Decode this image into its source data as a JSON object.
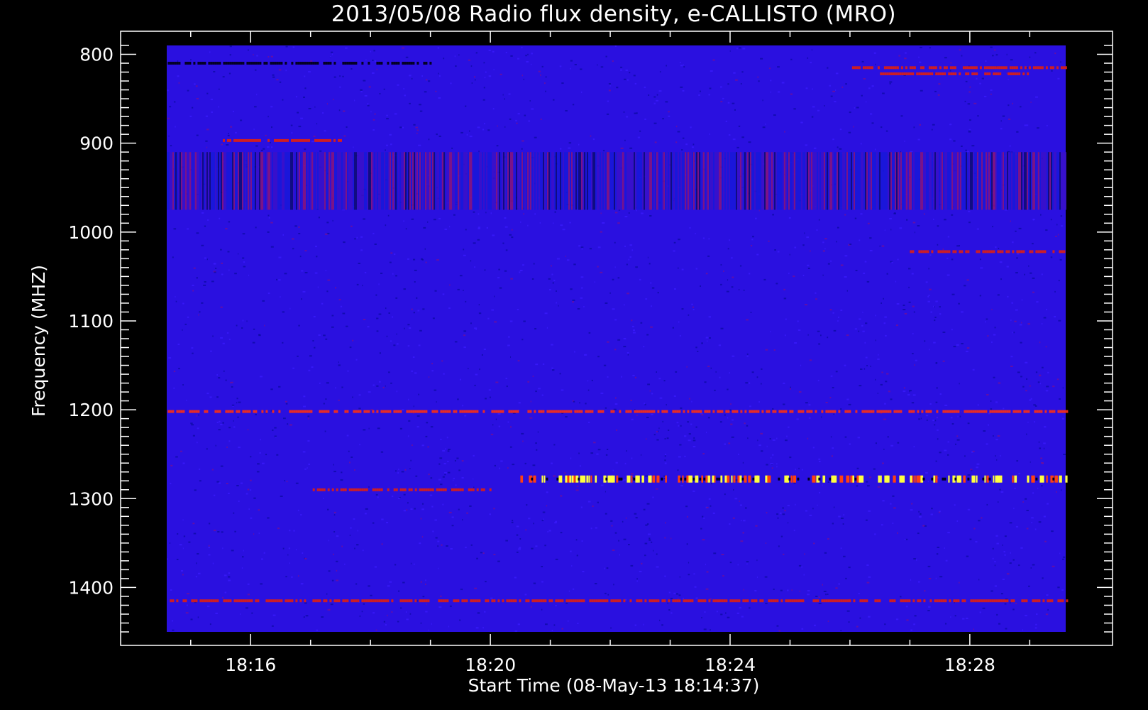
{
  "chart_data": {
    "type": "heatmap",
    "title": "2013/05/08  Radio flux density, e-CALLISTO (MRO)",
    "xlabel": "Start Time (08-May-13 18:14:37)",
    "ylabel": "Frequency (MHZ)",
    "x_start": "18:14:37",
    "x_end": "18:29:37",
    "xlim_minutes_after_18_00": [
      14.6,
      29.6
    ],
    "ylim": [
      1450,
      790
    ],
    "y_axis_inverted": true,
    "x_ticks": [
      "18:16",
      "18:20",
      "18:24",
      "18:28"
    ],
    "y_ticks": [
      800,
      900,
      1000,
      1100,
      1200,
      1300,
      1400
    ],
    "colormap": [
      "#000000",
      "#0000ff",
      "#ff0000",
      "#ffff00"
    ],
    "background_color": "#2a10e0",
    "features": [
      {
        "type": "band",
        "freq": 810,
        "level": "low",
        "t_start": "18:14:37",
        "t_end": "18:19:00"
      },
      {
        "type": "band",
        "freq": 815,
        "level": "high",
        "t_start": "18:26:00",
        "t_end": "18:29:37"
      },
      {
        "type": "band",
        "freq": 822,
        "level": "high",
        "t_start": "18:26:30",
        "t_end": "18:29:00"
      },
      {
        "type": "band",
        "freq": 897,
        "level": "high",
        "t_start": "18:15:30",
        "t_end": "18:17:30"
      },
      {
        "type": "striated_region",
        "freq_range": [
          910,
          975
        ]
      },
      {
        "type": "band",
        "freq": 1022,
        "level": "high",
        "t_start": "18:27:00",
        "t_end": "18:29:37"
      },
      {
        "type": "band",
        "freq": 1202,
        "level": "medium",
        "t_start": "18:14:37",
        "t_end": "18:29:37"
      },
      {
        "type": "band",
        "freq": 1278,
        "level": "burst",
        "t_start": "18:20:30",
        "t_end": "18:29:37"
      },
      {
        "type": "band",
        "freq": 1290,
        "level": "high",
        "t_start": "18:17:00",
        "t_end": "18:20:00"
      },
      {
        "type": "band",
        "freq": 1415,
        "level": "high",
        "t_start": "18:14:37",
        "t_end": "18:29:37"
      }
    ]
  }
}
